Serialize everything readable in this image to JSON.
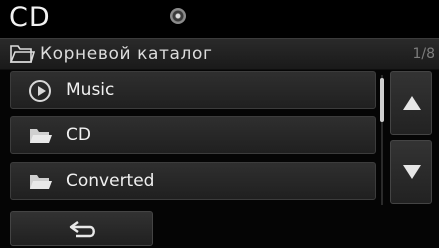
{
  "header": {
    "title": "CD",
    "disc_icon": "disc-icon"
  },
  "path": {
    "label": "Корневой каталог",
    "page_indicator": "1/8",
    "icon": "folder-outline-icon"
  },
  "list": {
    "items": [
      {
        "label": "Music",
        "icon": "play-circle-icon"
      },
      {
        "label": "CD",
        "icon": "folder-icon"
      },
      {
        "label": "Converted",
        "icon": "folder-icon"
      }
    ]
  },
  "controls": {
    "scroll_up_icon": "arrow-up-icon",
    "scroll_down_icon": "arrow-down-icon",
    "back_icon": "back-arrow-icon"
  },
  "colors": {
    "background": "#050505",
    "text": "#f0f0f0",
    "button_top": "#333333",
    "button_bottom": "#202020"
  }
}
